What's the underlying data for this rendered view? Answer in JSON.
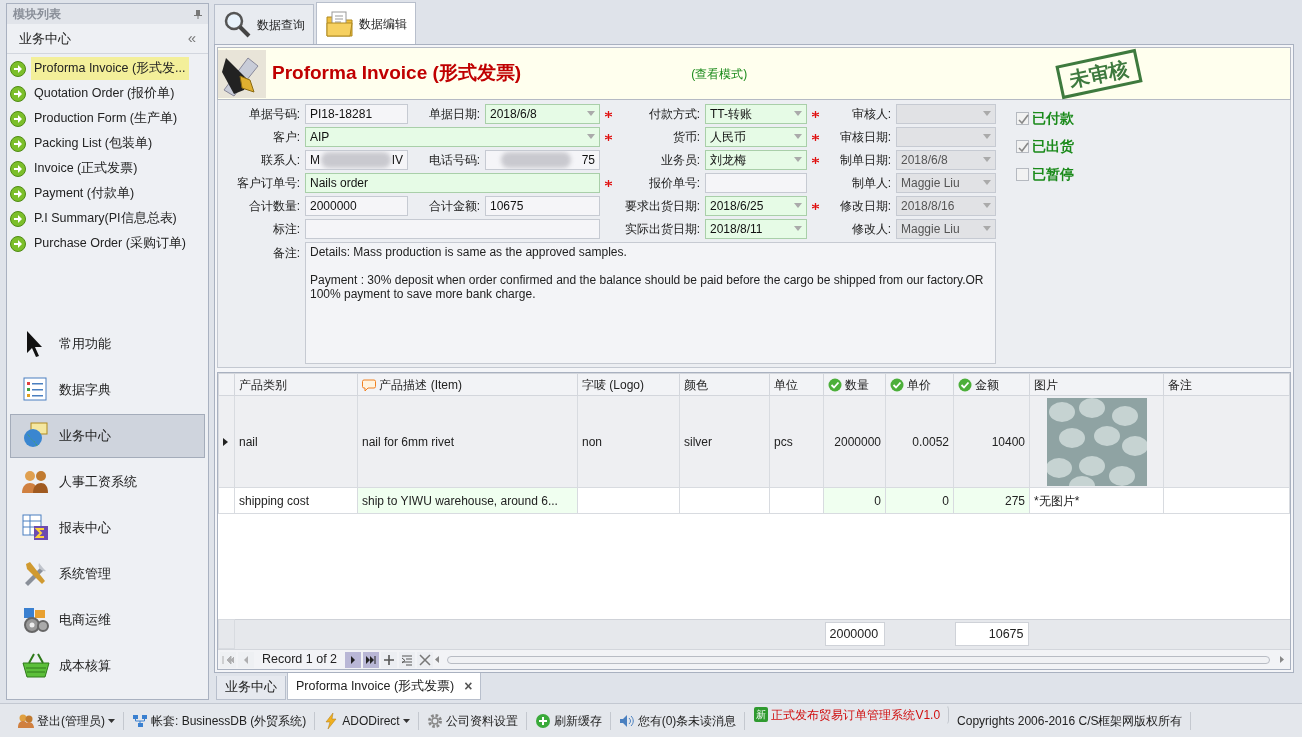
{
  "sidebar": {
    "title": "模块列表",
    "section": {
      "label": "业务中心",
      "collapse": "«"
    },
    "items": [
      {
        "label": "Proforma Invoice (形式发...",
        "selected": true
      },
      {
        "label": "Quotation Order (报价单)",
        "selected": false
      },
      {
        "label": "Production Form (生产单)",
        "selected": false
      },
      {
        "label": "Packing List (包装单)",
        "selected": false
      },
      {
        "label": "Invoice (正式发票)",
        "selected": false
      },
      {
        "label": "Payment (付款单)",
        "selected": false
      },
      {
        "label": "P.I Summary(PI信息总表)",
        "selected": false
      },
      {
        "label": "Purchase Order (采购订单)",
        "selected": false
      }
    ],
    "nav": [
      {
        "label": "常用功能",
        "selected": false
      },
      {
        "label": "数据字典",
        "selected": false
      },
      {
        "label": "业务中心",
        "selected": true
      },
      {
        "label": "人事工资系统",
        "selected": false
      },
      {
        "label": "报表中心",
        "selected": false
      },
      {
        "label": "系统管理",
        "selected": false
      },
      {
        "label": "电商运维",
        "selected": false
      },
      {
        "label": "成本核算",
        "selected": false
      }
    ]
  },
  "tabs": [
    {
      "label": "数据查询",
      "selected": false
    },
    {
      "label": "数据编辑",
      "selected": true
    }
  ],
  "header": {
    "title": "Proforma Invoice (形式发票)",
    "mode": "(查看模式)",
    "stamp": "未审核"
  },
  "form": {
    "left": [
      [
        {
          "label": "单据号码:",
          "value": "PI18-18281",
          "kind": "text",
          "editable": false,
          "disabled": false
        },
        {
          "label": "单据日期:",
          "value": "2018/6/8",
          "kind": "dropdown",
          "editable": true,
          "disabled": false,
          "required": true
        }
      ],
      [
        {
          "label": "客户:",
          "value": "AIP",
          "kind": "dropdown",
          "editable": true,
          "disabled": false,
          "required": true
        }
      ],
      [
        {
          "label": "联系人:",
          "kind": "masked",
          "visible_start": "M",
          "visible_end": "IV",
          "editable": false,
          "disabled": false
        },
        {
          "label": "电话号码:",
          "kind": "masked",
          "visible_end": "75",
          "editable": false,
          "disabled": false
        }
      ],
      [
        {
          "label": "客户订单号:",
          "value": "Nails order",
          "kind": "text",
          "editable": true,
          "disabled": false,
          "required": true
        }
      ],
      [
        {
          "label": "合计数量:",
          "value": "2000000",
          "kind": "text",
          "editable": false,
          "disabled": false
        },
        {
          "label": "合计金额:",
          "value": "10675",
          "kind": "text",
          "editable": false,
          "disabled": false
        }
      ],
      [
        {
          "label": "标注:",
          "kind": "text",
          "editable": false,
          "disabled": false
        }
      ]
    ],
    "middle": [
      {
        "label": "付款方式:",
        "value": "TT-转账",
        "kind": "dropdown",
        "editable": true,
        "disabled": false,
        "required": true
      },
      {
        "label": "货币:",
        "value": "人民币",
        "kind": "dropdown",
        "editable": true,
        "disabled": false,
        "required": true
      },
      {
        "label": "业务员:",
        "value": "刘龙梅",
        "kind": "dropdown",
        "editable": true,
        "disabled": false,
        "required": true
      },
      {
        "label": "报价单号:",
        "kind": "text",
        "editable": false,
        "disabled": false
      },
      {
        "label": "要求出货日期:",
        "value": "2018/6/25",
        "kind": "dropdown",
        "editable": true,
        "disabled": false,
        "required": true
      },
      {
        "label": "实际出货日期:",
        "value": "2018/8/11",
        "kind": "dropdown",
        "editable": true,
        "disabled": false
      }
    ],
    "right": [
      {
        "label": "审核人:",
        "kind": "dropdown",
        "editable": false,
        "disabled": true
      },
      {
        "label": "审核日期:",
        "kind": "dropdown",
        "editable": false,
        "disabled": true
      },
      {
        "label": "制单日期:",
        "value": "2018/6/8",
        "kind": "dropdown",
        "editable": false,
        "disabled": true
      },
      {
        "label": "制单人:",
        "value": "Maggie Liu",
        "kind": "dropdown",
        "editable": false,
        "disabled": true
      },
      {
        "label": "修改日期:",
        "value": "2018/8/16",
        "kind": "dropdown",
        "editable": false,
        "disabled": true
      },
      {
        "label": "修改人:",
        "value": "Maggie Liu",
        "kind": "dropdown",
        "editable": false,
        "disabled": true
      }
    ],
    "flags": [
      {
        "label": "已付款",
        "checked": true
      },
      {
        "label": "已出货",
        "checked": true
      },
      {
        "label": "已暂停",
        "checked": false
      }
    ],
    "remarks": {
      "label": "备注:",
      "value": "Details: Mass production is same as the approved samples.\n\nPayment : 30% deposit when order confirmed and the balance should be paid before the cargo be shipped from our factory.OR 100% payment to save more bank charge."
    }
  },
  "table": {
    "columns": [
      {
        "label": "产品类别",
        "kind": "text"
      },
      {
        "label": "产品描述 (Item)",
        "kind": "note"
      },
      {
        "label": "字唛 (Logo)",
        "kind": "text"
      },
      {
        "label": "颜色",
        "kind": "text"
      },
      {
        "label": "单位",
        "kind": "text"
      },
      {
        "label": "数量",
        "kind": "verified",
        "total": "2000000"
      },
      {
        "label": "单价",
        "kind": "verified"
      },
      {
        "label": "金额",
        "kind": "verified",
        "total": "10675"
      },
      {
        "label": "图片",
        "kind": "text"
      },
      {
        "label": "备注",
        "kind": "text"
      }
    ],
    "rows": [
      {
        "selected": true,
        "cells": [
          "nail",
          "nail for 6mm rivet",
          "non",
          "silver",
          "pcs",
          "2000000",
          "0.0052",
          "10400",
          {
            "kind": "picture"
          }
        ]
      },
      {
        "selected": false,
        "cells": [
          "shipping cost",
          "ship to YIWU warehouse, around 6...",
          "",
          "",
          "",
          "0",
          "0",
          "275",
          "*无图片*"
        ]
      }
    ],
    "navigator": {
      "record": "Record 1 of 2",
      "buttons": [
        {
          "disabled": true
        },
        {
          "disabled": true
        },
        {
          "disabled": false
        },
        {
          "disabled": false
        },
        {
          "disabled": false
        },
        {
          "disabled": false
        },
        {
          "disabled": false
        }
      ]
    }
  },
  "doc_tabs": [
    {
      "label": "业务中心",
      "selected": false,
      "closable": false
    },
    {
      "label": "Proforma Invoice (形式发票)",
      "selected": true,
      "closable": true,
      "close": "×"
    }
  ],
  "status_bar": [
    {
      "text": "登出(管理员)",
      "dropdown": true,
      "alert": false
    },
    {
      "text": "帐套: BusinessDB (外贸系统)",
      "dropdown": false,
      "alert": false
    },
    {
      "text": "ADODirect",
      "dropdown": true,
      "alert": false
    },
    {
      "text": "公司资料设置",
      "dropdown": false,
      "alert": false
    },
    {
      "text": "刷新缓存",
      "dropdown": false,
      "alert": false
    },
    {
      "text": "您有(0)条未读消息",
      "dropdown": false,
      "alert": false
    },
    {
      "text": "正式发布贸易订单管理系统V1.0",
      "dropdown": false,
      "alert": true,
      "badge": "新"
    },
    {
      "text": "Copyrights 2006-2016 C/S框架网版权所有",
      "dropdown": false,
      "alert": false
    }
  ]
}
